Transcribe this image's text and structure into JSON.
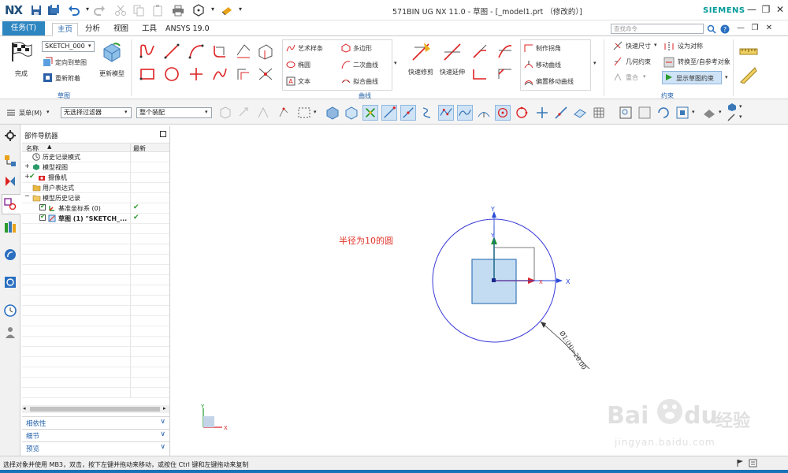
{
  "window": {
    "app_logo": "NX",
    "title": "571BIN UG NX 11.0 - 草图 - [_model1.prt （修改的）]",
    "brand": "SIEMENS",
    "minimize_icon": "minimize-icon",
    "restore_icon": "restore-icon",
    "close_icon": "close-icon"
  },
  "tabs": {
    "task": "任务(T)",
    "items": [
      "主页",
      "分析",
      "视图",
      "工具",
      "ANSYS 19.0"
    ],
    "active": "主页",
    "search_placeholder": "查找命令"
  },
  "ribbon": {
    "finish_label": "完成",
    "sketch_name": "SKETCH_000",
    "orient_label": "定向到草图",
    "reattach_label": "重新附着",
    "update_model_label": "更新模型",
    "sketch_group": "草图",
    "curve_group": "曲线",
    "constraint_group": "约束",
    "curve_panel": {
      "art_spline": "艺术样条",
      "ellipse": "椭圆",
      "text": "文本",
      "polygon": "多边形",
      "conic": "二次曲线",
      "fit_curve": "拟合曲线"
    },
    "quick_trim": "快速修剪",
    "quick_extend": "快速延伸",
    "make_corner": "制作拐角",
    "move_curve": "移动曲线",
    "offset_move_curve": "偏置移动曲线",
    "quick_dimension": "快速尺寸",
    "geometric_constraint": "几何约束",
    "set_symmetric": "设为对称",
    "convert_reference": "转换至/自参考对象",
    "overlay": "重合",
    "show_sketch_constraints": "显示草图约束"
  },
  "toolbar2": {
    "menu_label": "菜单(M)",
    "filter_value": "无选择过滤器",
    "assembly_value": "整个装配"
  },
  "navigator": {
    "title": "部件导航器",
    "col_name": "名称",
    "col_latest": "最新",
    "rows": [
      {
        "label": "历史记录模式",
        "latest": ""
      },
      {
        "label": "模型视图",
        "latest": ""
      },
      {
        "label": "摄像机",
        "latest": ""
      },
      {
        "label": "用户表达式",
        "latest": ""
      },
      {
        "label": "模型历史记录",
        "latest": ""
      },
      {
        "label": "基准坐标系 (0)",
        "latest": "✔"
      },
      {
        "label": "草图 (1) \"SKETCH_...",
        "latest": "✔"
      }
    ],
    "sections": [
      "相依性",
      "细节",
      "预览"
    ]
  },
  "canvas": {
    "annotation": "半径为10的圆",
    "dimension_text": "Ø1:(H)=20.00",
    "axis_x": "X",
    "axis_y": "Y",
    "mini_x": "X",
    "mini_y": "Y"
  },
  "status": {
    "message": "选择对象并使用 MB3，双击，按下左键并拖动来移动，或按住 Ctrl 键和左键拖动来复制"
  },
  "watermark": {
    "text1": "Bai",
    "text2": "du",
    "text3": "经验",
    "url": "jingyan.baidu.com"
  },
  "colors": {
    "accent": "#2e86c1",
    "annotation": "#e0342a",
    "sketch_curve": "#3a3ad8",
    "green_axis": "#1a9a2a",
    "red_axis": "#d9262c",
    "status_bar": "#1a72b8"
  }
}
